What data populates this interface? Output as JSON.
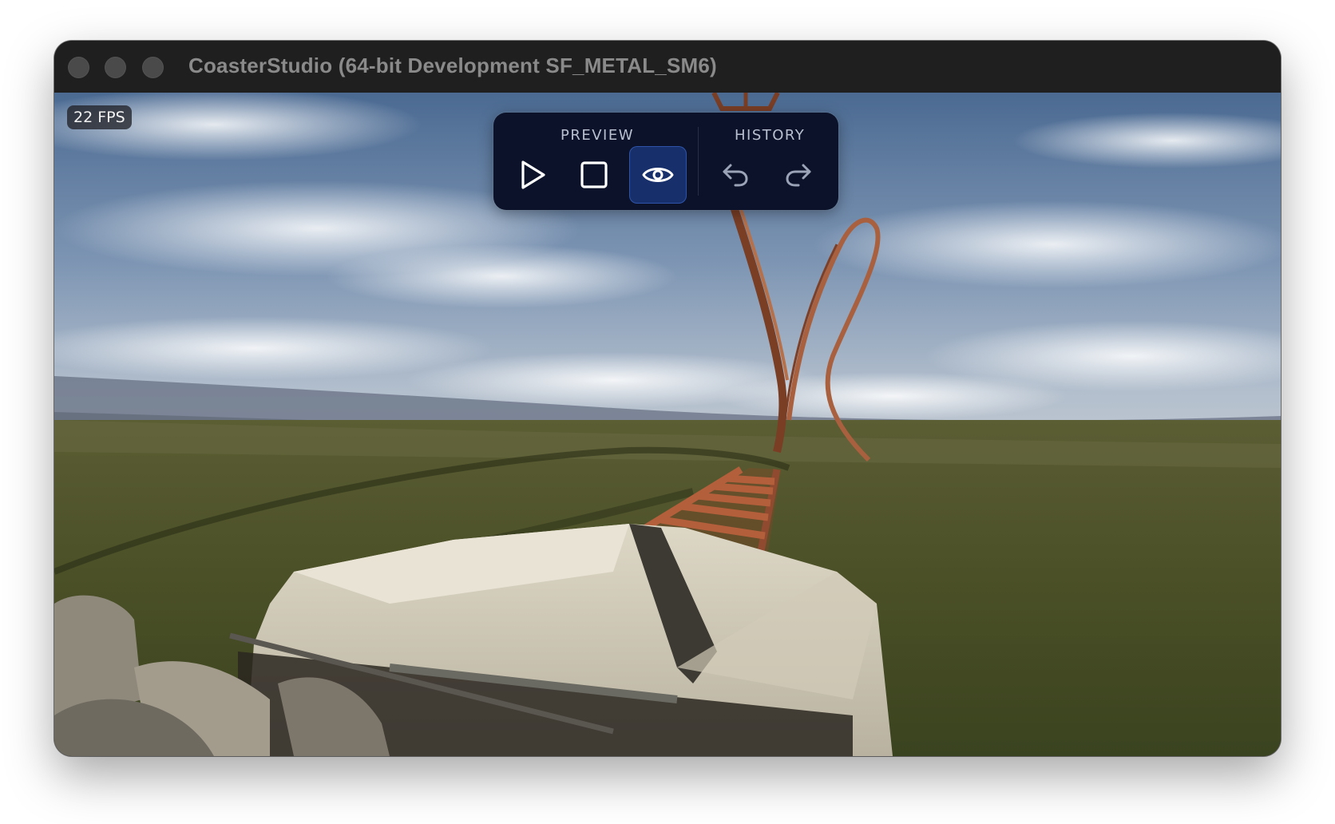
{
  "window": {
    "title": "CoasterStudio (64-bit Development SF_METAL_SM6)"
  },
  "viewport": {
    "fps_label": "22 FPS"
  },
  "toolbar": {
    "preview_label": "PREVIEW",
    "history_label": "HISTORY",
    "buttons": [
      {
        "id": "play",
        "icon": "play-icon",
        "active": false
      },
      {
        "id": "stop",
        "icon": "stop-icon",
        "active": false
      },
      {
        "id": "preview",
        "icon": "eye-icon",
        "active": true
      },
      {
        "id": "undo",
        "icon": "undo-icon",
        "active": false
      },
      {
        "id": "redo",
        "icon": "redo-icon",
        "active": false
      }
    ],
    "colors": {
      "panel_bg": "#0b1229",
      "active_bg": "#17306b",
      "icon": "#ffffff",
      "icon_muted": "#9aa3b8"
    }
  }
}
